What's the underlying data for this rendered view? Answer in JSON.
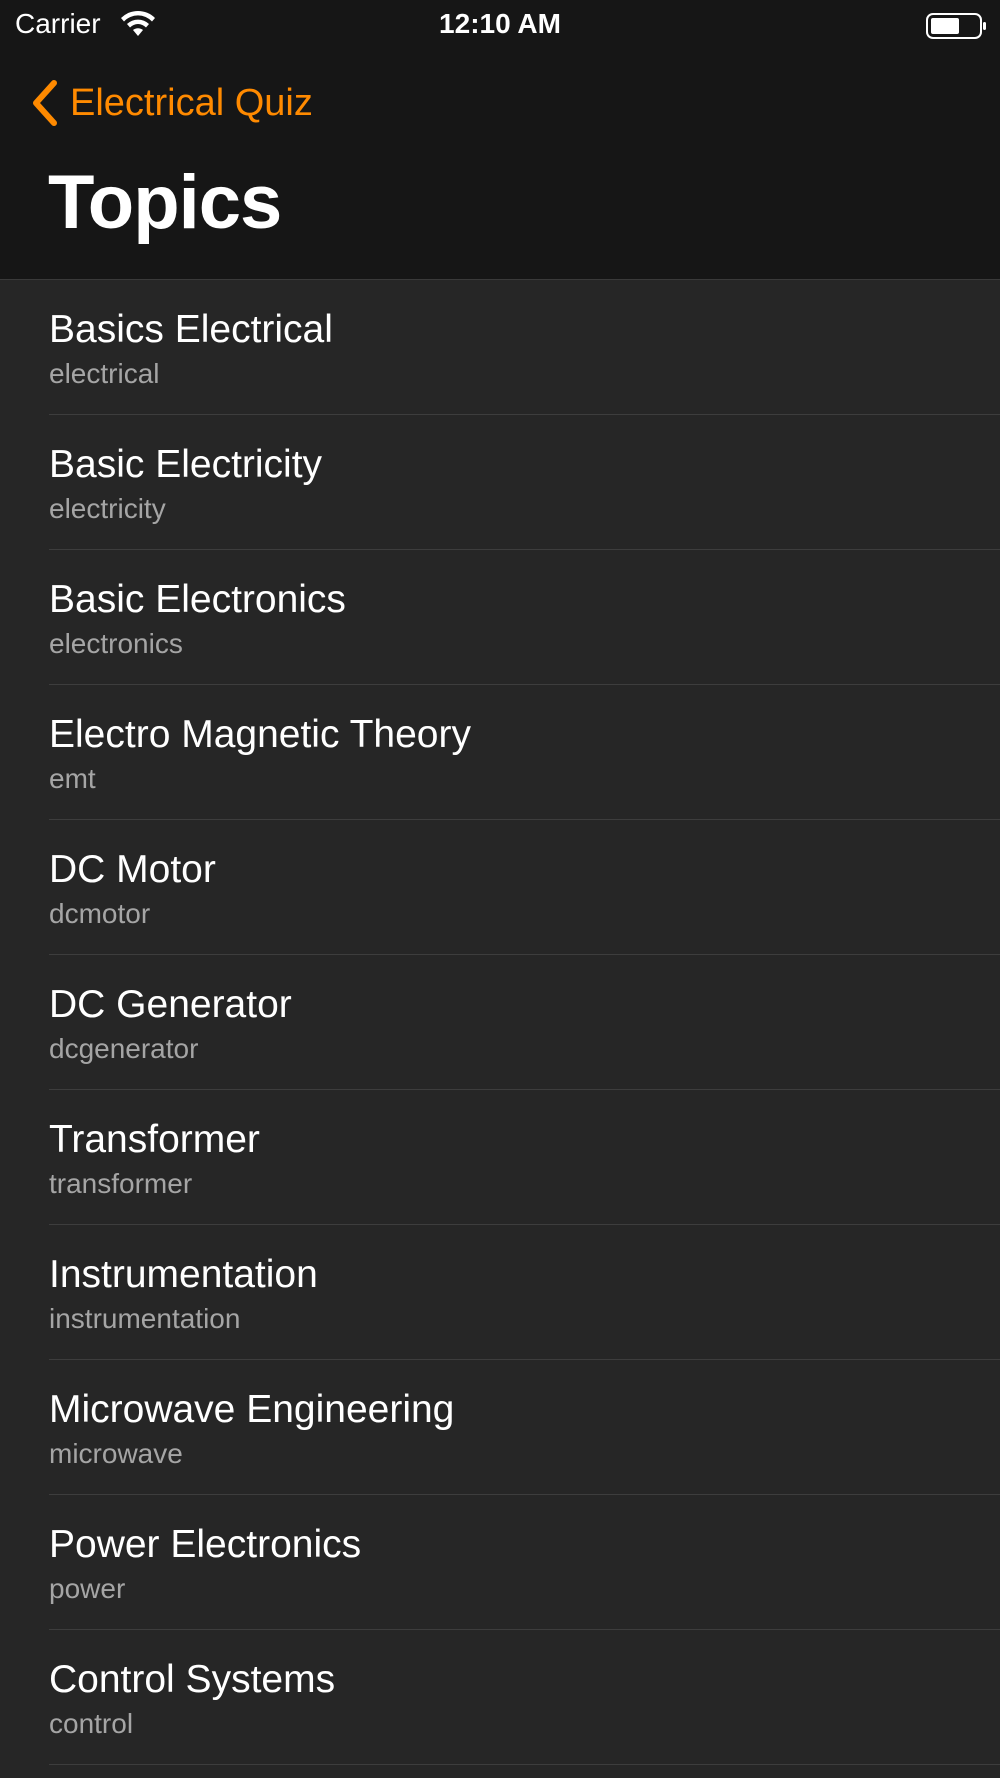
{
  "status_bar": {
    "carrier": "Carrier",
    "time": "12:10 AM",
    "wifi_icon": "wifi-icon",
    "battery_icon": "battery-icon"
  },
  "nav": {
    "back_label": "Electrical Quiz",
    "back_icon": "chevron-left-icon",
    "title": "Topics",
    "accent_color": "#ff8a00"
  },
  "topics": [
    {
      "title": "Basics Electrical",
      "subtitle": "electrical"
    },
    {
      "title": "Basic Electricity",
      "subtitle": "electricity"
    },
    {
      "title": "Basic Electronics",
      "subtitle": "electronics"
    },
    {
      "title": "Electro Magnetic Theory",
      "subtitle": "emt"
    },
    {
      "title": "DC Motor",
      "subtitle": "dcmotor"
    },
    {
      "title": "DC Generator",
      "subtitle": "dcgenerator"
    },
    {
      "title": "Transformer",
      "subtitle": "transformer"
    },
    {
      "title": "Instrumentation",
      "subtitle": "instrumentation"
    },
    {
      "title": "Microwave Engineering",
      "subtitle": "microwave"
    },
    {
      "title": "Power Electronics",
      "subtitle": "power"
    },
    {
      "title": "Control Systems",
      "subtitle": "control"
    }
  ]
}
